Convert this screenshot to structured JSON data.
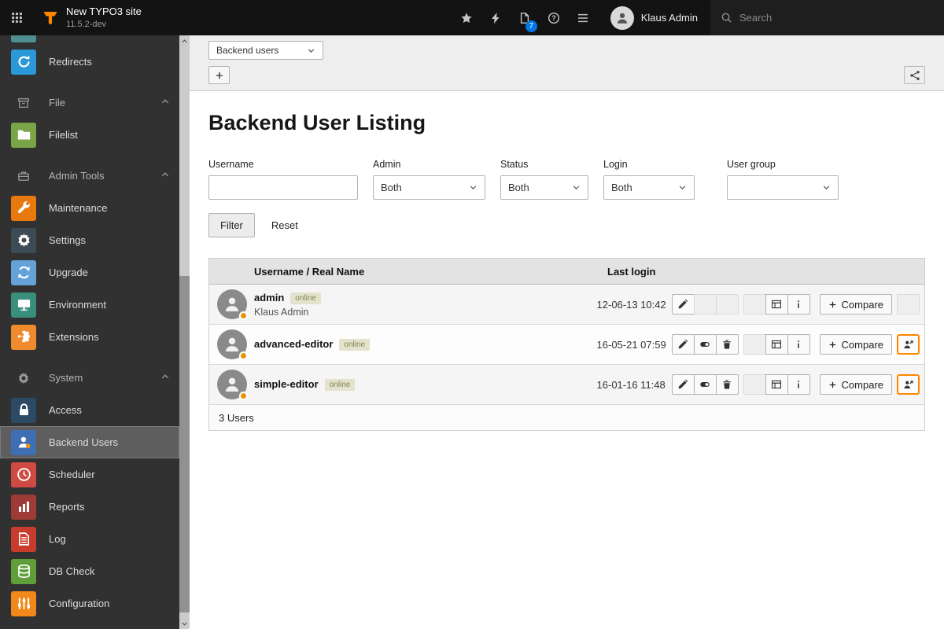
{
  "colors": {
    "accent_orange": "#ff8700",
    "badge_blue": "#0078e6",
    "selected_module_bg": "#5e5e5e"
  },
  "topbar": {
    "site_title": "New TYPO3 site",
    "site_version": "11.5.2-dev",
    "toolbar_items": [
      {
        "name": "bookmarks",
        "icon": "star"
      },
      {
        "name": "clear-cache",
        "icon": "bolt"
      },
      {
        "name": "opened-documents",
        "icon": "document",
        "badge": "7"
      },
      {
        "name": "help",
        "icon": "help"
      },
      {
        "name": "system-information",
        "icon": "sysinfo"
      }
    ],
    "user_name": "Klaus Admin",
    "search_placeholder": "Search"
  },
  "sidebar": {
    "items": [
      {
        "type": "module",
        "label": "",
        "icon": "bars",
        "color": "#4f8f8f"
      },
      {
        "type": "module",
        "label": "Redirects",
        "icon": "refresh",
        "color": "#2b98d8"
      },
      {
        "type": "header",
        "label": "File",
        "icon": "archive"
      },
      {
        "type": "module",
        "label": "Filelist",
        "icon": "folder",
        "color": "#79a548"
      },
      {
        "type": "header",
        "label": "Admin Tools",
        "icon": "toolbox"
      },
      {
        "type": "module",
        "label": "Maintenance",
        "icon": "wrench",
        "color": "#e8790e"
      },
      {
        "type": "module",
        "label": "Settings",
        "icon": "gear",
        "color": "#3d4c54"
      },
      {
        "type": "module",
        "label": "Upgrade",
        "icon": "upgrade",
        "color": "#64a2d8"
      },
      {
        "type": "module",
        "label": "Environment",
        "icon": "monitor",
        "color": "#3a8f7c"
      },
      {
        "type": "module",
        "label": "Extensions",
        "icon": "puzzle",
        "color": "#ef8b2c"
      },
      {
        "type": "header",
        "label": "System",
        "icon": "gear"
      },
      {
        "type": "module",
        "label": "Access",
        "icon": "lock",
        "color": "#2c4a63"
      },
      {
        "type": "module",
        "label": "Backend Users",
        "icon": "busers",
        "color": "#3e6fb5",
        "selected": true
      },
      {
        "type": "module",
        "label": "Scheduler",
        "icon": "clock",
        "color": "#cf4a42"
      },
      {
        "type": "module",
        "label": "Reports",
        "icon": "chart",
        "color": "#9e3b36"
      },
      {
        "type": "module",
        "label": "Log",
        "icon": "logdoc",
        "color": "#c83c2e"
      },
      {
        "type": "module",
        "label": "DB Check",
        "icon": "dbcheck",
        "color": "#5f9e3a"
      },
      {
        "type": "module",
        "label": "Configuration",
        "icon": "sliders",
        "color": "#f0881c"
      }
    ]
  },
  "docheader": {
    "module_select_value": "Backend users"
  },
  "page": {
    "title": "Backend User Listing"
  },
  "filters": {
    "username": {
      "label": "Username",
      "value": ""
    },
    "admin": {
      "label": "Admin",
      "value": "Both"
    },
    "status": {
      "label": "Status",
      "value": "Both"
    },
    "login": {
      "label": "Login",
      "value": "Both"
    },
    "usergroup": {
      "label": "User group",
      "value": ""
    },
    "filter_button": "Filter",
    "reset_button": "Reset"
  },
  "table": {
    "columns": {
      "user": "Username / Real Name",
      "last_login": "Last login"
    },
    "compare_label": "Compare",
    "footer": "3 Users",
    "rows": [
      {
        "username": "admin",
        "badge": "online",
        "realname": "Klaus Admin",
        "last_login": "12-06-13 10:42",
        "actions": {
          "edit": true,
          "hide": false,
          "delete": false,
          "lock": false,
          "records": true,
          "info": true,
          "switch_user": false
        }
      },
      {
        "username": "advanced-editor",
        "badge": "online",
        "realname": "",
        "last_login": "16-05-21 07:59",
        "actions": {
          "edit": true,
          "hide": true,
          "delete": true,
          "lock": false,
          "records": true,
          "info": true,
          "switch_user": true
        }
      },
      {
        "username": "simple-editor",
        "badge": "online",
        "realname": "",
        "last_login": "16-01-16 11:48",
        "actions": {
          "edit": true,
          "hide": true,
          "delete": true,
          "lock": false,
          "records": true,
          "info": true,
          "switch_user": true
        }
      }
    ]
  }
}
